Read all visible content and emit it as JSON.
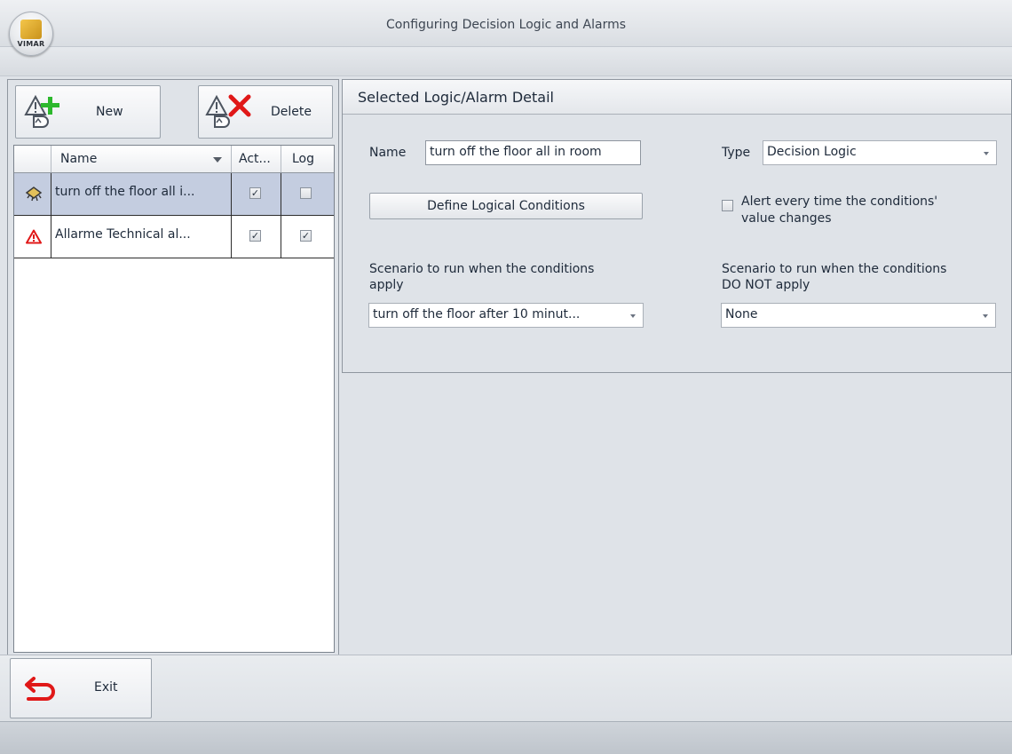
{
  "window": {
    "title": "Configuring Decision Logic and Alarms",
    "logo_text": "VIMAR"
  },
  "toolbar": {
    "new_label": "New",
    "delete_label": "Delete"
  },
  "grid": {
    "columns": [
      "Name",
      "Act...",
      "Log"
    ],
    "rows": [
      {
        "name": "turn off the floor all i...",
        "active": true,
        "log": false,
        "icon": "logic-chip-icon",
        "selected": true
      },
      {
        "name": "Allarme Technical al...",
        "active": true,
        "log": true,
        "icon": "alarm-warning-icon",
        "selected": false
      }
    ]
  },
  "detail": {
    "title": "Selected Logic/Alarm Detail",
    "name_label": "Name",
    "name_value": "turn off the floor all in room",
    "type_label": "Type",
    "type_value": "Decision Logic",
    "define_button": "Define Logical Conditions",
    "alert_label_line1": "Alert every time the conditions'",
    "alert_label_line2": "value changes",
    "alert_checked": false,
    "scenario_apply_label_line1": "Scenario to run when the conditions",
    "scenario_apply_label_line2": "apply",
    "scenario_apply_value": "turn off the floor after 10 minut...",
    "scenario_not_apply_label_line1": "Scenario to run when the conditions",
    "scenario_not_apply_label_line2": "DO NOT apply",
    "scenario_not_apply_value": "None"
  },
  "footer": {
    "exit_label": "Exit"
  },
  "colors": {
    "selected_row": "#c4cde0",
    "new_plus": "#2db82d",
    "delete_x": "#e01818",
    "exit_arrow": "#e01818"
  }
}
